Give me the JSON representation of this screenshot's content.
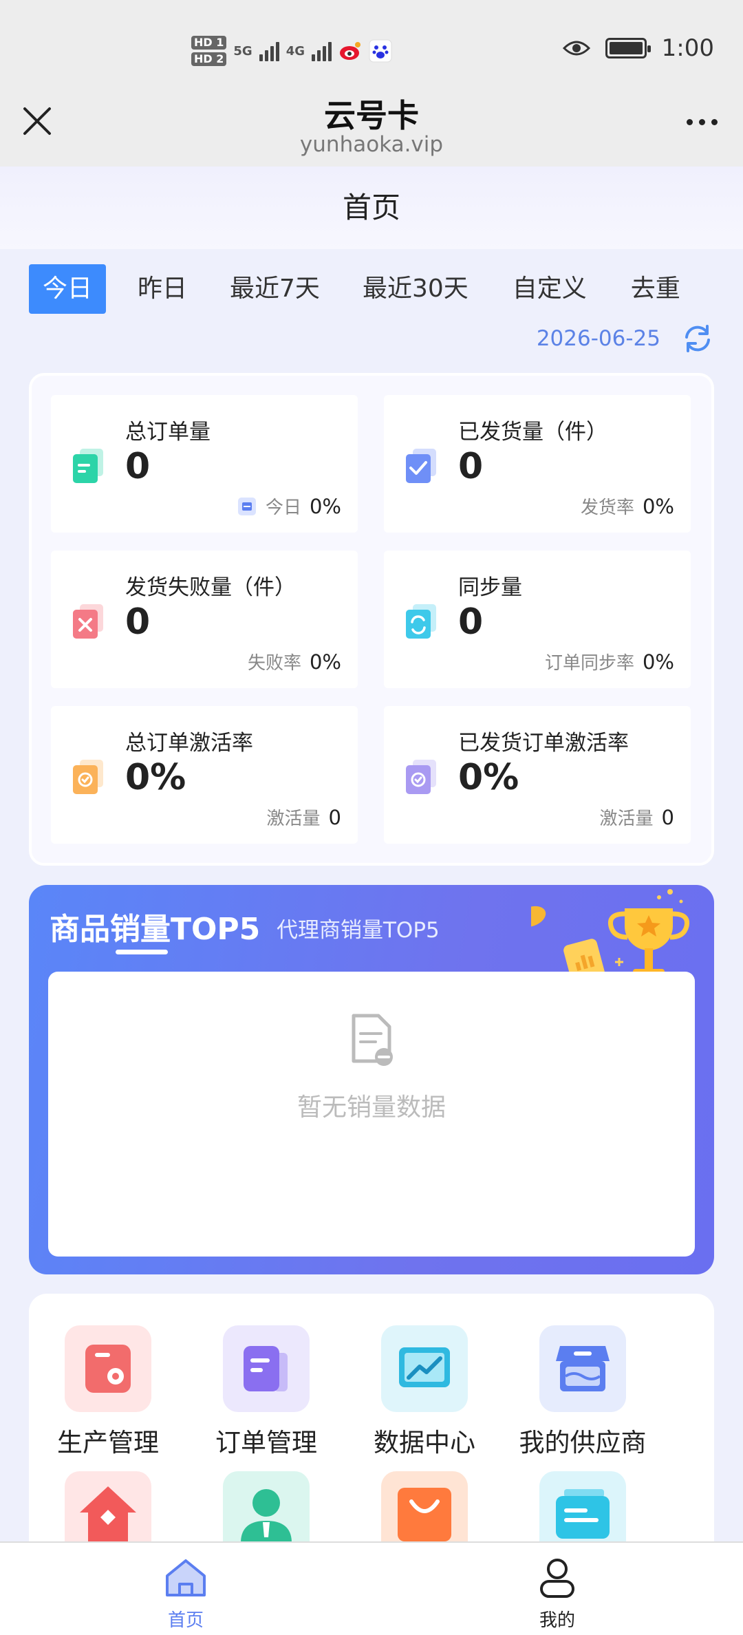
{
  "status_bar": {
    "sim1": "HD 1",
    "sim2": "HD 2",
    "net1": "5G",
    "net2": "4G",
    "time": "1:00",
    "icons": [
      "weibo-icon",
      "baidu-icon",
      "eye-icon",
      "battery-icon"
    ]
  },
  "app": {
    "title": "云号卡",
    "url": "yunhaoka.vip"
  },
  "page": {
    "title": "首页"
  },
  "tabs": [
    "今日",
    "昨日",
    "最近7天",
    "最近30天",
    "自定义",
    "去重"
  ],
  "active_tab": "今日",
  "date": "2026-06-25",
  "stats": [
    {
      "label": "总订单量",
      "value": "0",
      "sub_label": "今日",
      "sub_value": "0%",
      "color": "#2cd4a8"
    },
    {
      "label": "已发货量（件）",
      "value": "0",
      "sub_label": "发货率",
      "sub_value": "0%",
      "color": "#6f8ff7"
    },
    {
      "label": "发货失败量（件）",
      "value": "0",
      "sub_label": "失败率",
      "sub_value": "0%",
      "color": "#f47a86"
    },
    {
      "label": "同步量",
      "value": "0",
      "sub_label": "订单同步率",
      "sub_value": "0%",
      "color": "#3ec9ea"
    },
    {
      "label": "总订单激活率",
      "value": "0%",
      "sub_label": "激活量",
      "sub_value": "0",
      "color": "#fbb259"
    },
    {
      "label": "已发货订单激活率",
      "value": "0%",
      "sub_label": "激活量",
      "sub_value": "0",
      "color": "#a99af2"
    }
  ],
  "sales": {
    "tab_products": "商品销量TOP5",
    "tab_agents": "代理商销量TOP5",
    "empty_text": "暂无销量数据"
  },
  "menu": [
    {
      "label": "生产管理",
      "icon": "production-icon",
      "bg": "#ffe6e6",
      "fg": "#f26c6c"
    },
    {
      "label": "订单管理",
      "icon": "order-icon",
      "bg": "#ece8fd",
      "fg": "#8a6ff0"
    },
    {
      "label": "数据中心",
      "icon": "data-center-icon",
      "bg": "#dff5fb",
      "fg": "#2fb9e0"
    },
    {
      "label": "我的供应商",
      "icon": "supplier-icon",
      "bg": "#e6ecfd",
      "fg": "#5b7ef0"
    },
    {
      "label": "",
      "icon": "home-shop-icon",
      "bg": "#ffe6e6",
      "fg": "#f25a5a"
    },
    {
      "label": "",
      "icon": "user-icon",
      "bg": "#dbf6ef",
      "fg": "#2ebf94"
    },
    {
      "label": "",
      "icon": "bag-icon",
      "bg": "#ffe4d4",
      "fg": "#ff7a3d"
    },
    {
      "label": "",
      "icon": "card-icon",
      "bg": "#dcf5fb",
      "fg": "#2ec4e6"
    }
  ],
  "bottom_nav": [
    {
      "label": "首页",
      "icon": "home-icon",
      "active": true
    },
    {
      "label": "我的",
      "icon": "person-icon",
      "active": false
    }
  ]
}
